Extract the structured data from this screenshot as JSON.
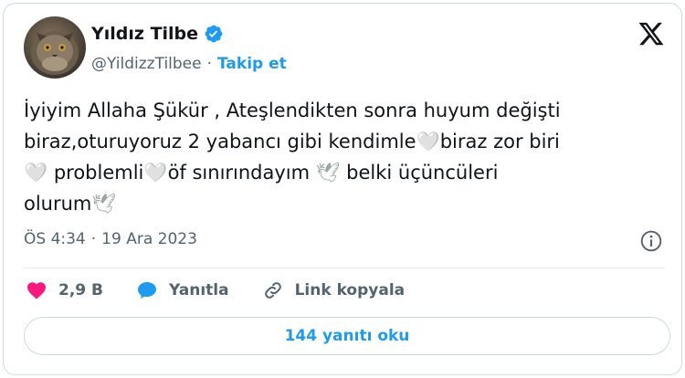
{
  "author": {
    "display_name": "Yıldız Tilbe",
    "handle": "@YildizzTilbee",
    "separator": "·",
    "follow_label": "Takip et",
    "verified": true
  },
  "tweet": {
    "line1": "İyiyim Allaha Şükür , Ateşlendikten sonra huyum değişti",
    "line2a": "biraz,oturuyoruz 2 yabancı gibi kendimle",
    "line2b": "biraz zor biri",
    "line3a": " problemli",
    "line3b": "öf sınırındayım ",
    "line3c": " belki üçüncüleri",
    "line4a": "olurum",
    "white_heart": "🤍",
    "dove": "🕊"
  },
  "meta": {
    "time": "ÖS 4:34",
    "separator": "·",
    "date": "19 Ara 2023"
  },
  "actions": {
    "likes": "2,9 B",
    "reply_label": "Yanıtla",
    "copy_link_label": "Link kopyala"
  },
  "replies_button": "144 yanıtı oku",
  "colors": {
    "accent": "#1d9bf0",
    "like": "#f91880",
    "secondary_text": "#536471"
  },
  "icons": {
    "brand": "x-logo-icon",
    "verified": "verified-badge-icon",
    "info": "info-icon",
    "like": "heart-icon",
    "reply": "reply-bubble-icon",
    "link": "link-icon"
  }
}
